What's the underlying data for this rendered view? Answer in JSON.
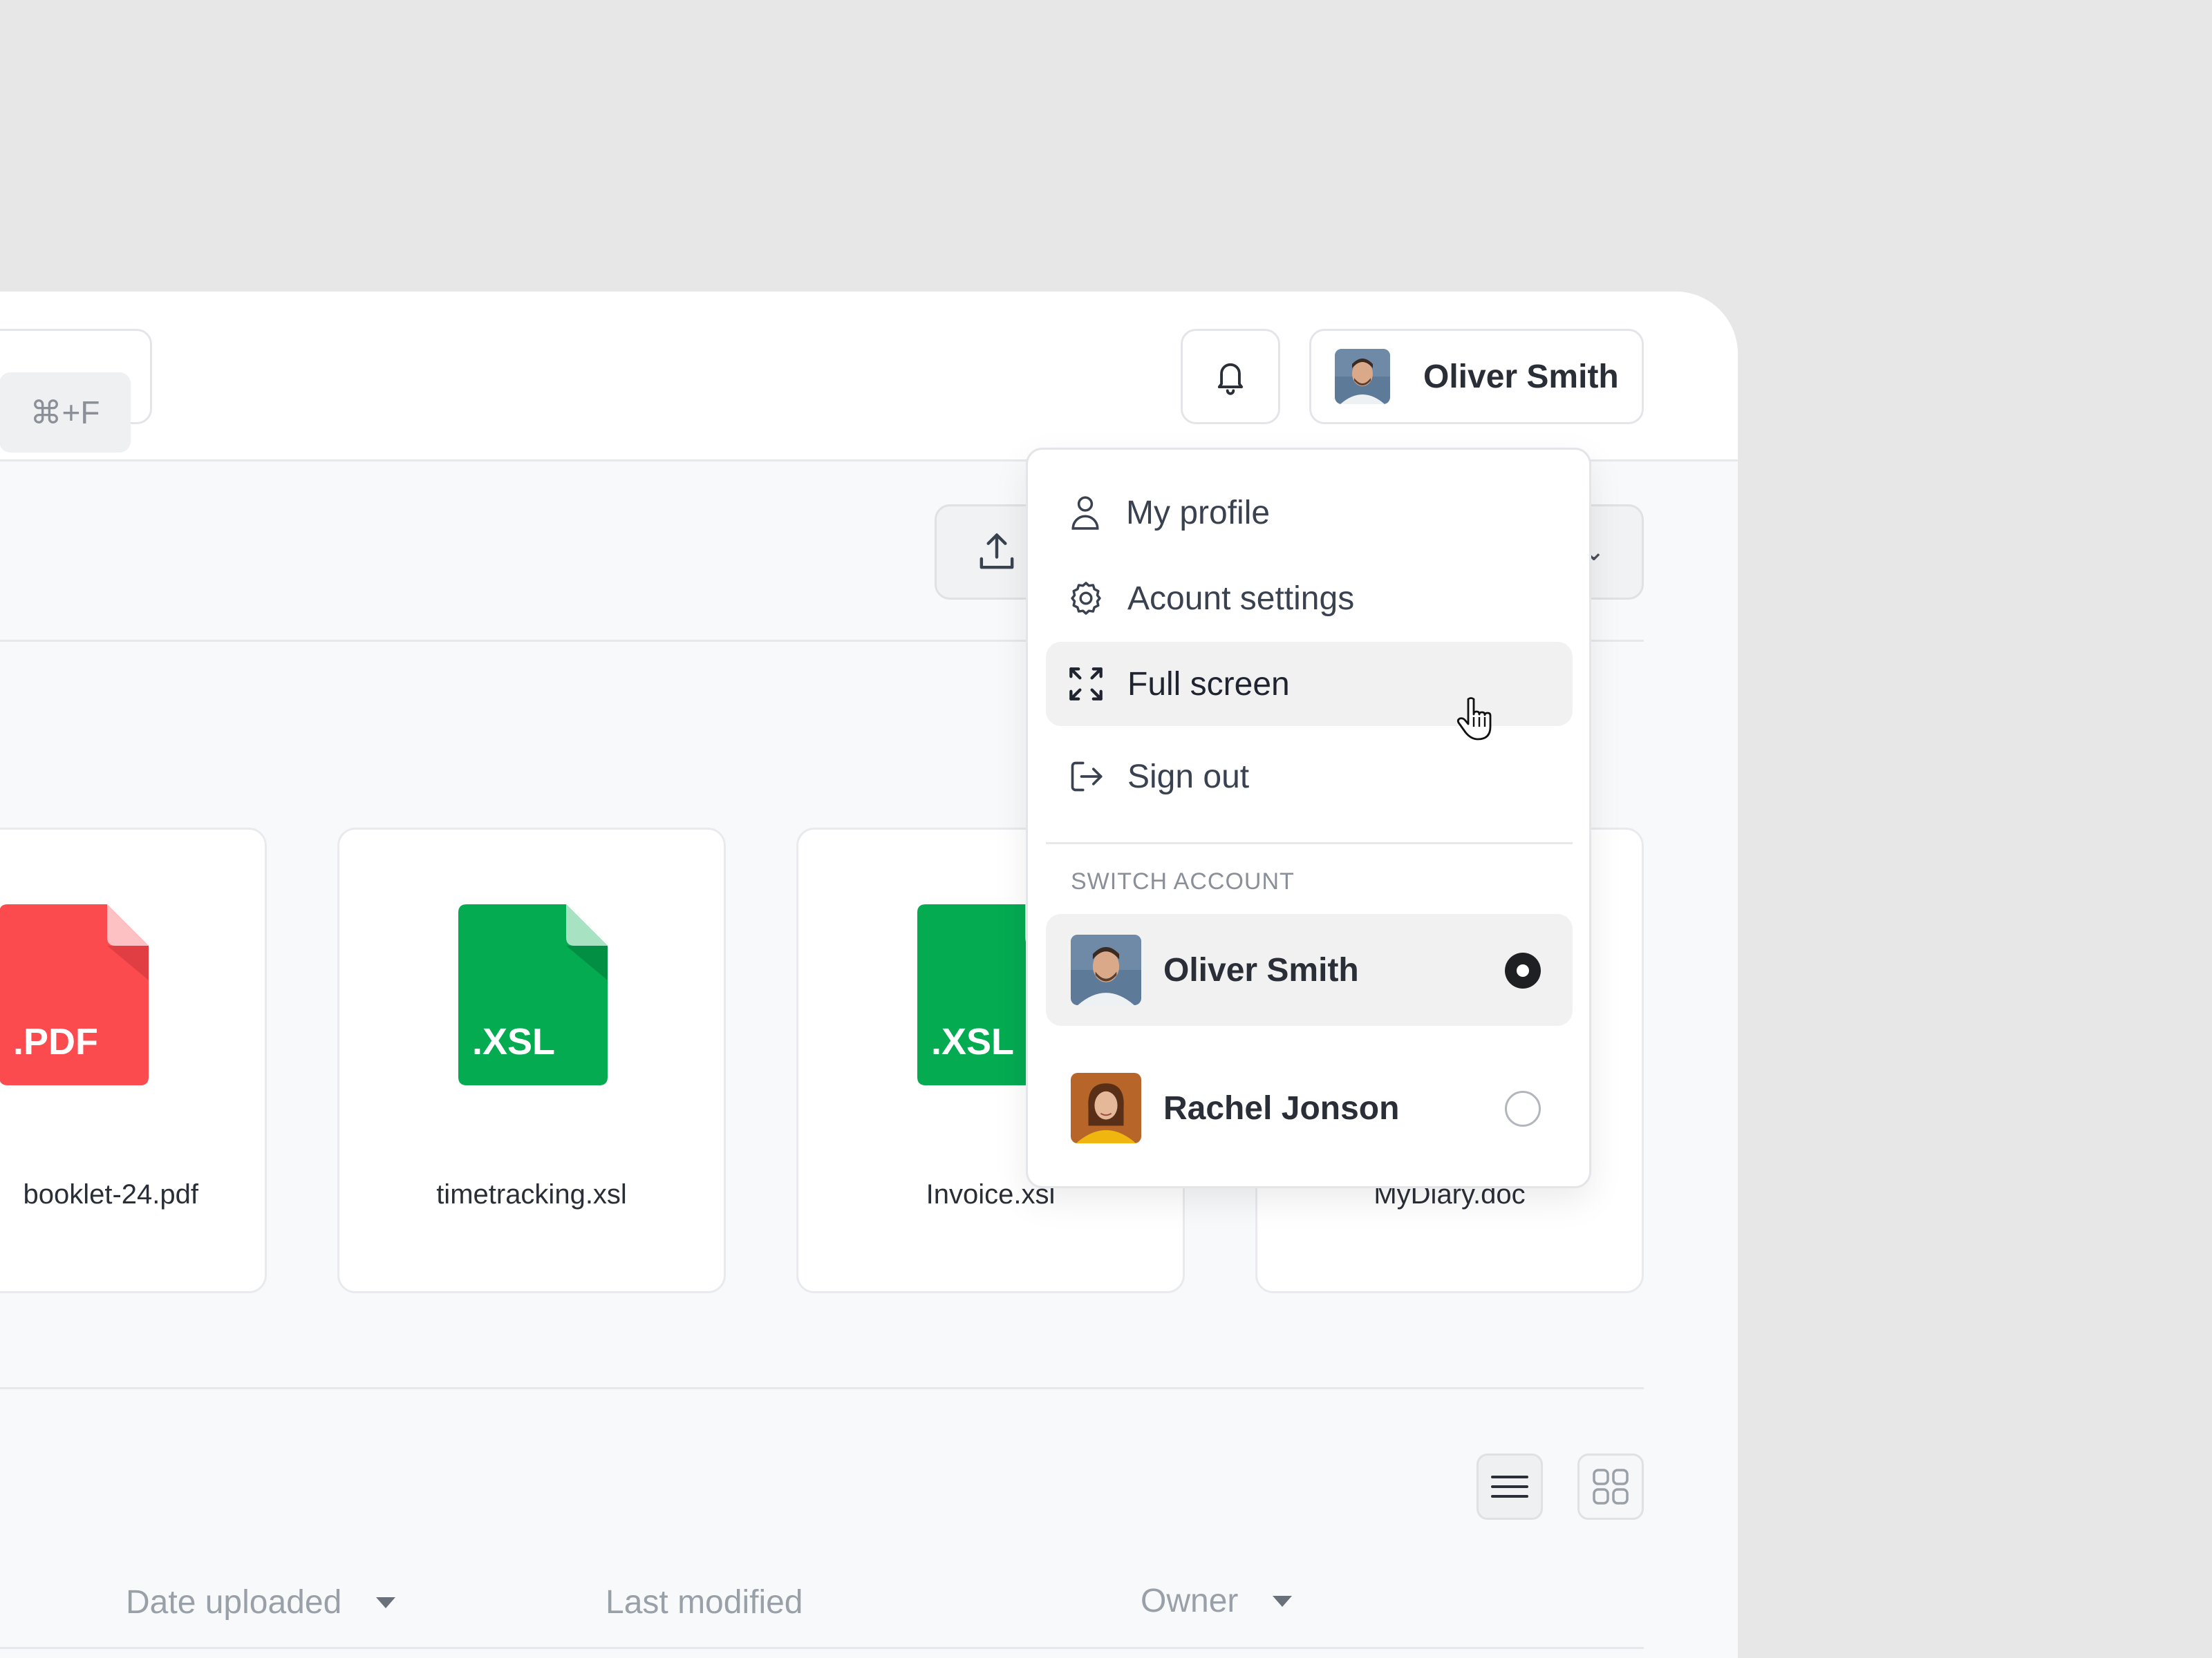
{
  "search": {
    "shortcut": "⌘+F"
  },
  "header": {
    "user_name": "Oliver Smith",
    "notifications_icon": "bell-icon",
    "avatar_icon": "user-avatar"
  },
  "toolbar": {
    "upload_icon": "upload-icon"
  },
  "files": [
    {
      "name": "booklet-24.pdf",
      "ext": ".PDF",
      "color": "#fc4b4f"
    },
    {
      "name": "timetracking.xsl",
      "ext": ".XSL",
      "color": "#04ab51"
    },
    {
      "name": "Invoice.xsl",
      "ext": ".XSL",
      "color": "#04ab51"
    },
    {
      "name": "MyDiary.doc",
      "ext": "",
      "color": ""
    }
  ],
  "view_toggle": {
    "list_icon": "list-view-icon",
    "grid_icon": "grid-view-icon"
  },
  "table": {
    "columns": [
      "Date uploaded",
      "Last modified",
      "Owner"
    ]
  },
  "menu": {
    "items": [
      {
        "label": "My profile",
        "icon": "user-icon"
      },
      {
        "label": "Acount settings",
        "icon": "gear-icon"
      },
      {
        "label": "Full screen",
        "icon": "fullscreen-icon"
      },
      {
        "label": "Sign out",
        "icon": "sign-out-icon"
      }
    ],
    "section_title": "SWITCH ACCOUNT",
    "accounts": [
      {
        "name": "Oliver Smith",
        "selected": true
      },
      {
        "name": "Rachel Jonson",
        "selected": false
      }
    ]
  },
  "colors": {
    "pdf": "#fc4b4f",
    "xsl": "#04ab51",
    "hover_bg": "#f1f1f2"
  }
}
